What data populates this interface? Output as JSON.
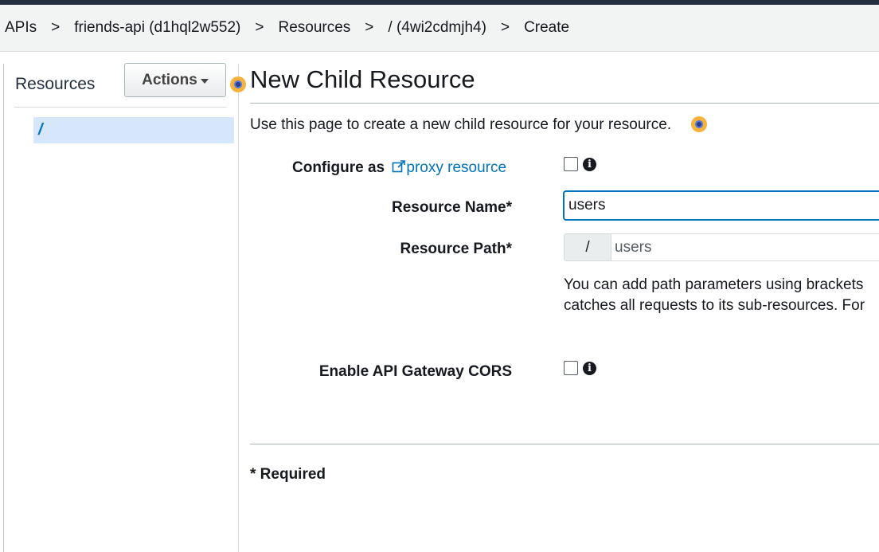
{
  "breadcrumb": {
    "items": [
      "APIs",
      "friends-api (d1hql2w552)",
      "Resources",
      "/ (4wi2cdmjh4)",
      "Create"
    ],
    "separator": ">"
  },
  "sidebar": {
    "title": "Resources",
    "actions_label": "Actions",
    "tree": [
      {
        "label": "/",
        "selected": true
      }
    ]
  },
  "main": {
    "title": "New Child Resource",
    "intro": "Use this page to create a new child resource for your resource.",
    "form": {
      "configure_label": "Configure as",
      "proxy_link": "proxy resource",
      "proxy_checked": false,
      "name_label": "Resource Name*",
      "name_value": "users",
      "path_label": "Resource Path*",
      "path_prefix": "/",
      "path_value": "users",
      "help_line_1": "You can add path parameters using brackets",
      "help_line_2": "catches all requests to its sub-resources. For",
      "cors_label": "Enable API Gateway CORS",
      "cors_checked": false
    },
    "required_note": "* Required"
  },
  "icons": {
    "info": "info-icon",
    "external_link": "external-link-icon",
    "help_marker": "help-marker-icon",
    "dropdown": "caret-down-icon"
  },
  "colors": {
    "link": "#0073bb",
    "selected_row": "#d6e6fb",
    "header_bar": "#232f3e",
    "help_marker": "#f7b23b"
  }
}
